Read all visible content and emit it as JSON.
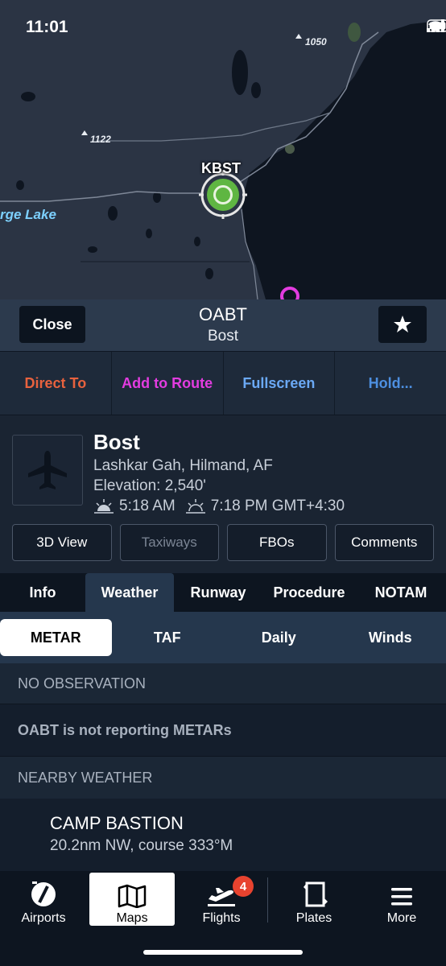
{
  "status_bar": {
    "time": "11:01"
  },
  "map": {
    "elevation_labels": [
      "1050",
      "1122"
    ],
    "lake_label": "rge Lake",
    "airport_marker": "KBST"
  },
  "header": {
    "close_label": "Close",
    "title": "OABT",
    "subtitle": "Bost",
    "favorite_icon": "star-icon"
  },
  "actions": [
    {
      "label": "Direct To",
      "color": "#e8623e"
    },
    {
      "label": "Add to Route",
      "color": "#e33ce0"
    },
    {
      "label": "Fullscreen",
      "color": "#6ba9f5"
    },
    {
      "label": "Hold...",
      "color": "#4d8fe0"
    }
  ],
  "airport": {
    "name": "Bost",
    "location": "Lashkar Gah, Hilmand, AF",
    "elevation": "Elevation: 2,540'",
    "sunrise": "5:18 AM",
    "sunset": "7:18 PM GMT+4:30",
    "buttons": [
      {
        "label": "3D View",
        "enabled": true
      },
      {
        "label": "Taxiways",
        "enabled": false
      },
      {
        "label": "FBOs",
        "enabled": true
      },
      {
        "label": "Comments",
        "enabled": true
      }
    ]
  },
  "tabs": [
    {
      "label": "Info",
      "active": false
    },
    {
      "label": "Weather",
      "active": true
    },
    {
      "label": "Runway",
      "active": false
    },
    {
      "label": "Procedure",
      "active": false
    },
    {
      "label": "NOTAM",
      "active": false
    }
  ],
  "subtabs": [
    {
      "label": "METAR",
      "active": true
    },
    {
      "label": "TAF",
      "active": false
    },
    {
      "label": "Daily",
      "active": false
    },
    {
      "label": "Winds",
      "active": false
    }
  ],
  "weather": {
    "no_obs_header": "NO OBSERVATION",
    "no_obs_message": "OABT is not reporting METARs",
    "nearby_header": "NEARBY WEATHER",
    "nearby_station": {
      "name": "CAMP BASTION",
      "detail": "20.2nm NW, course 333°M"
    }
  },
  "tabbar": {
    "items": [
      {
        "label": "Airports",
        "icon": "airport-icon",
        "active": false
      },
      {
        "label": "Maps",
        "icon": "map-icon",
        "active": true
      },
      {
        "label": "Flights",
        "icon": "flight-icon",
        "active": false,
        "badge": "4"
      },
      {
        "label": "Plates",
        "icon": "plates-icon",
        "active": false
      },
      {
        "label": "More",
        "icon": "menu-icon",
        "active": false
      }
    ]
  }
}
